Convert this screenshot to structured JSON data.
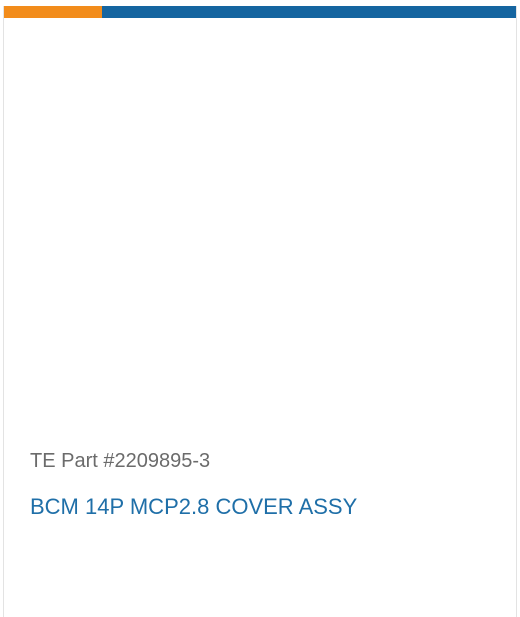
{
  "card": {
    "accent_color": "#f28c1b",
    "brand_color": "#1565a0",
    "part_number": "TE Part #2209895-3",
    "title": "BCM 14P MCP2.8 COVER ASSY"
  }
}
